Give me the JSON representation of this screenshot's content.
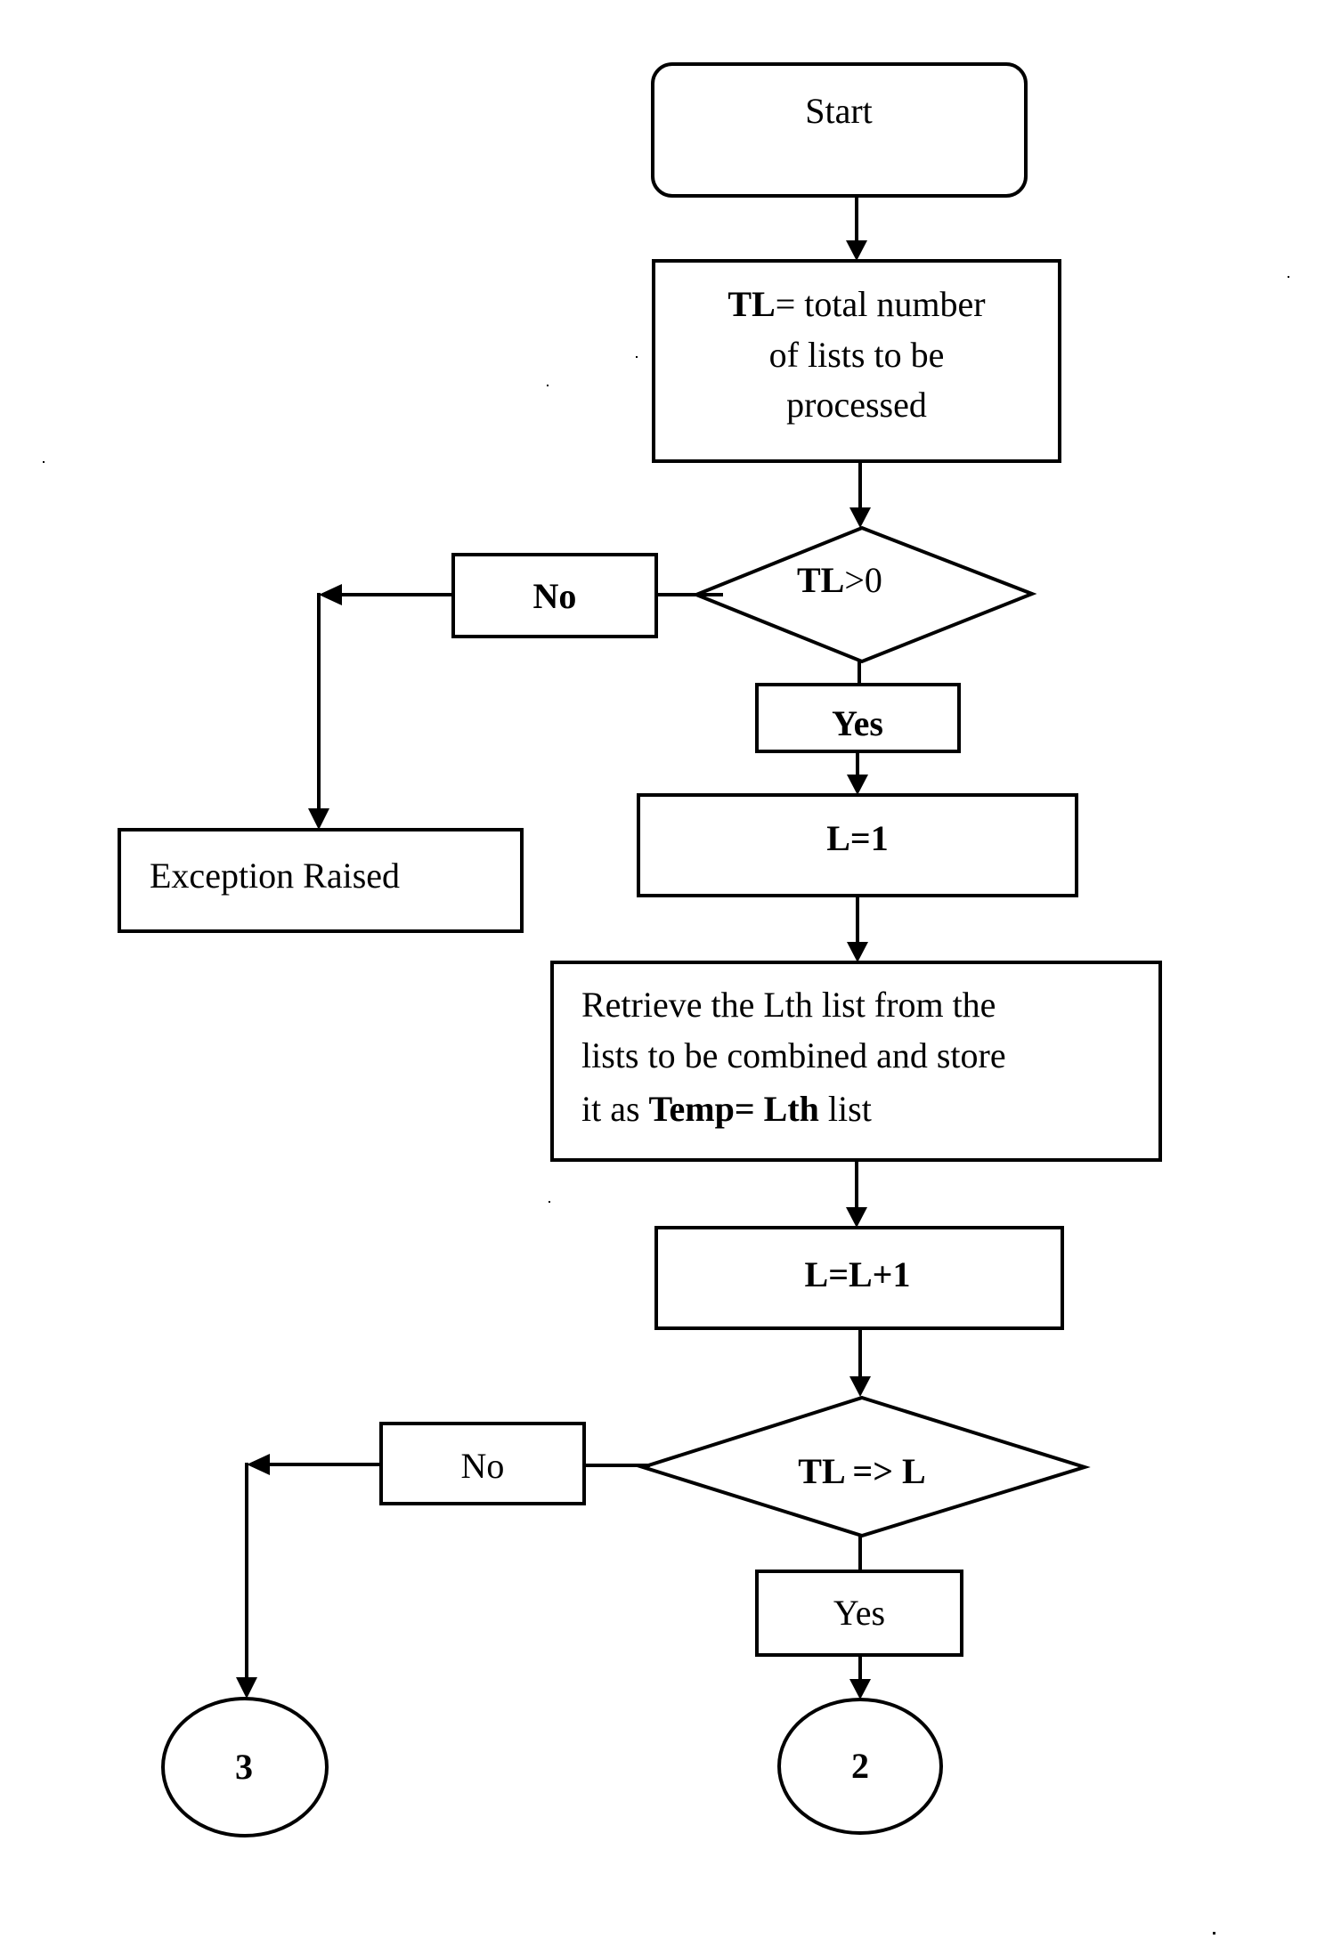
{
  "diagram": {
    "type": "flowchart",
    "nodes": {
      "start": {
        "shape": "rounded-rectangle",
        "label": "Start"
      },
      "init_tl": {
        "shape": "rectangle",
        "lines": [
          {
            "bold": "TL",
            "regular": "= total number"
          },
          {
            "regular": "of lists to be"
          },
          {
            "regular": "processed"
          }
        ]
      },
      "check_tl": {
        "shape": "diamond",
        "bold": "TL",
        "regular": ">0",
        "label": "TL>0"
      },
      "no_1": {
        "shape": "rectangle",
        "label": "No",
        "bold": true
      },
      "exception": {
        "shape": "rectangle",
        "label": "Exception Raised"
      },
      "yes_1": {
        "shape": "rectangle",
        "label": "Yes",
        "bold": true
      },
      "init_l": {
        "shape": "rectangle",
        "label": "L=1",
        "bold": true
      },
      "retrieve": {
        "shape": "rectangle",
        "line1": "Retrieve the Lth list from the",
        "line2": "lists to be combined and store",
        "line3_pre": "it as ",
        "line3_bold": "Temp= Lth",
        "line3_post": " list"
      },
      "increment": {
        "shape": "rectangle",
        "label": "L=L+1",
        "bold": true
      },
      "check_l": {
        "shape": "diamond",
        "label": "TL => L",
        "bold": true
      },
      "no_2": {
        "shape": "rectangle",
        "label": "No"
      },
      "yes_2": {
        "shape": "rectangle",
        "label": "Yes"
      },
      "connector_3": {
        "shape": "ellipse",
        "label": "3"
      },
      "connector_2": {
        "shape": "ellipse",
        "label": "2"
      }
    },
    "edges": [
      {
        "from": "start",
        "to": "init_tl"
      },
      {
        "from": "init_tl",
        "to": "check_tl"
      },
      {
        "from": "check_tl",
        "to": "no_1"
      },
      {
        "from": "no_1",
        "to": "exception"
      },
      {
        "from": "check_tl",
        "to": "yes_1"
      },
      {
        "from": "yes_1",
        "to": "init_l"
      },
      {
        "from": "init_l",
        "to": "retrieve"
      },
      {
        "from": "retrieve",
        "to": "increment"
      },
      {
        "from": "increment",
        "to": "check_l"
      },
      {
        "from": "check_l",
        "to": "no_2"
      },
      {
        "from": "no_2",
        "to": "connector_3"
      },
      {
        "from": "check_l",
        "to": "yes_2"
      },
      {
        "from": "yes_2",
        "to": "connector_2"
      }
    ],
    "colors": {
      "stroke": "#000000",
      "background": "#ffffff",
      "text": "#000000"
    }
  }
}
